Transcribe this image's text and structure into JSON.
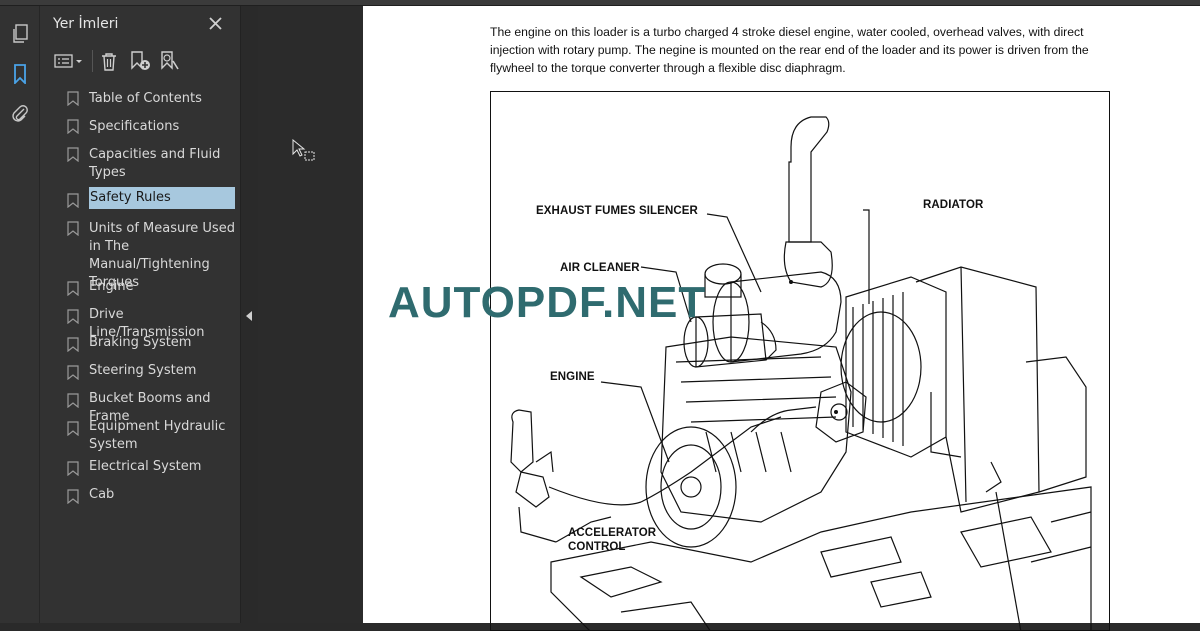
{
  "sidebar": {
    "title": "Yer İmleri",
    "bookmarks": [
      {
        "label": "Table of Contents"
      },
      {
        "label": "Specifications"
      },
      {
        "label": "Capacities and Fluid Types"
      },
      {
        "label": "Safety Rules"
      },
      {
        "label": "Units of Measure Used in The Manual/Tightening Torques"
      },
      {
        "label": "Engine"
      },
      {
        "label": "Drive Line/Transmission"
      },
      {
        "label": "Braking System"
      },
      {
        "label": "Steering System"
      },
      {
        "label": "Bucket Booms and Frame"
      },
      {
        "label": "Equipment Hydraulic System"
      },
      {
        "label": "Electrical System"
      },
      {
        "label": "Cab"
      }
    ],
    "selected_label": "Safety Rules"
  },
  "document": {
    "paragraph": "The engine on this loader is a turbo charged 4 stroke diesel engine, water cooled, overhead valves, with direct injection with rotary pump. The negine is mounted on the rear end of the loader and its power is driven from the flywheel to the torque converter through a flexible disc diaphragm.",
    "labels": {
      "exhaust": "EXHAUST FUMES SILENCER",
      "radiator": "RADIATOR",
      "air_cleaner": "AIR CLEANER",
      "engine": "ENGINE",
      "accelerator_1": "ACCELERATOR",
      "accelerator_2": "CONTROL"
    }
  },
  "watermark": "AUTOPDF.NET",
  "colors": {
    "selected": "#a7c8de",
    "watermark": "#2f6b6f"
  },
  "icons": [
    "pages-icon",
    "bookmark-icon",
    "attachment-icon",
    "close-icon",
    "options-icon",
    "delete-icon",
    "add-bookmark-icon",
    "find-bookmark-icon",
    "collapse-arrow-icon",
    "bookmark-item-icon",
    "cursor-icon"
  ]
}
